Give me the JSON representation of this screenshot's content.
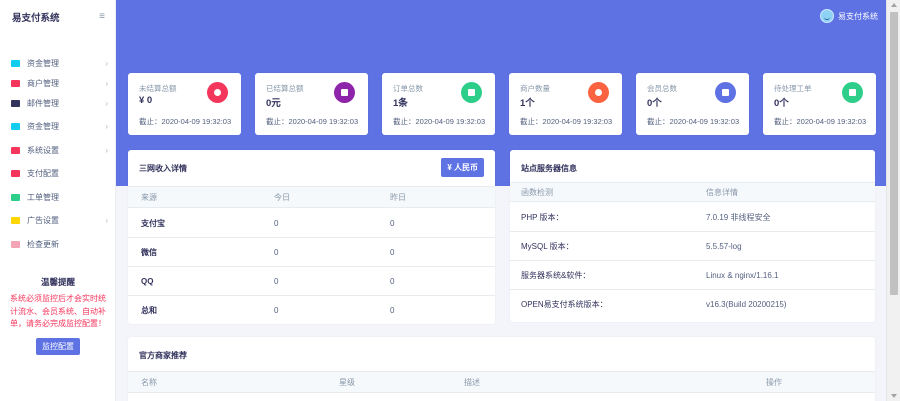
{
  "brand": {
    "name": "易支付系统"
  },
  "user": {
    "name": "易支付系统"
  },
  "sidebar": {
    "items": [
      {
        "label": "资金管理",
        "icon": "wallet-icon",
        "color": "#11cdef",
        "has_children": true
      },
      {
        "label": "商户管理",
        "icon": "user-icon",
        "color": "#f5365c",
        "has_children": true
      },
      {
        "label": "邮件管理",
        "icon": "mail-icon",
        "color": "#32325d",
        "has_children": true
      },
      {
        "label": "资金管理",
        "icon": "wallet-icon",
        "color": "#11cdef",
        "has_children": true
      },
      {
        "label": "系统设置",
        "icon": "settings-icon",
        "color": "#f5365c",
        "has_children": true
      },
      {
        "label": "支付配置",
        "icon": "tag-icon",
        "color": "#f5365c",
        "has_children": false
      },
      {
        "label": "工单管理",
        "icon": "send-icon",
        "color": "#2dce89",
        "has_children": false
      },
      {
        "label": "广告设置",
        "icon": "ad-icon",
        "color": "#ffd600",
        "has_children": true
      },
      {
        "label": "检查更新",
        "icon": "update-icon",
        "color": "#f3a4b5",
        "has_children": false
      }
    ],
    "notice": {
      "title": "温馨提醒",
      "text": "系统必须监控后才会实时统计流水、会员系统、自动补单，请务必完成监控配置！",
      "button": "监控配置"
    }
  },
  "stats": [
    {
      "label": "未结算总额",
      "value": "¥ 0",
      "date": "截止：2020-04-09 19:32:03",
      "icon": "pie-chart-icon",
      "color": "#f5365c"
    },
    {
      "label": "已结算总额",
      "value": "0元",
      "date": "截止：2020-04-09 19:32:03",
      "icon": "wallet-icon",
      "color": "#8e24aa"
    },
    {
      "label": "订单总数",
      "value": "1条",
      "date": "截止：2020-04-09 19:32:03",
      "icon": "cart-icon",
      "color": "#2dce89"
    },
    {
      "label": "商户数量",
      "value": "1个",
      "date": "截止：2020-04-09 19:32:03",
      "icon": "user-circle-icon",
      "color": "#fb6340"
    },
    {
      "label": "会员总数",
      "value": "0个",
      "date": "截止：2020-04-09 19:32:03",
      "icon": "box-icon",
      "color": "#5e72e4"
    },
    {
      "label": "待处理工单",
      "value": "0个",
      "date": "截止：2020-04-09 19:32:03",
      "icon": "send-icon",
      "color": "#2dce89"
    }
  ],
  "income": {
    "title": "三网收入详情",
    "currency_button": "¥ 人民币",
    "headers": [
      "来源",
      "今日",
      "昨日"
    ],
    "rows": [
      [
        "支付宝",
        "0",
        "0"
      ],
      [
        "微信",
        "0",
        "0"
      ],
      [
        "QQ",
        "0",
        "0"
      ],
      [
        "总和",
        "0",
        "0"
      ]
    ]
  },
  "server": {
    "title": "站点服务器信息",
    "headers": [
      "函数检测",
      "信息详情"
    ],
    "rows": [
      [
        "PHP 版本：",
        "7.0.19 非线程安全"
      ],
      [
        "MySQL 版本：",
        "5.5.57-log"
      ],
      [
        "服务器系统&软件：",
        "Linux & nginx/1.16.1"
      ],
      [
        "OPEN易支付系统版本：",
        "v16.3(Build 20200215)"
      ]
    ]
  },
  "merchants": {
    "title": "官方商家推荐",
    "headers": [
      "名称",
      "星级",
      "描述",
      "操作"
    ]
  }
}
